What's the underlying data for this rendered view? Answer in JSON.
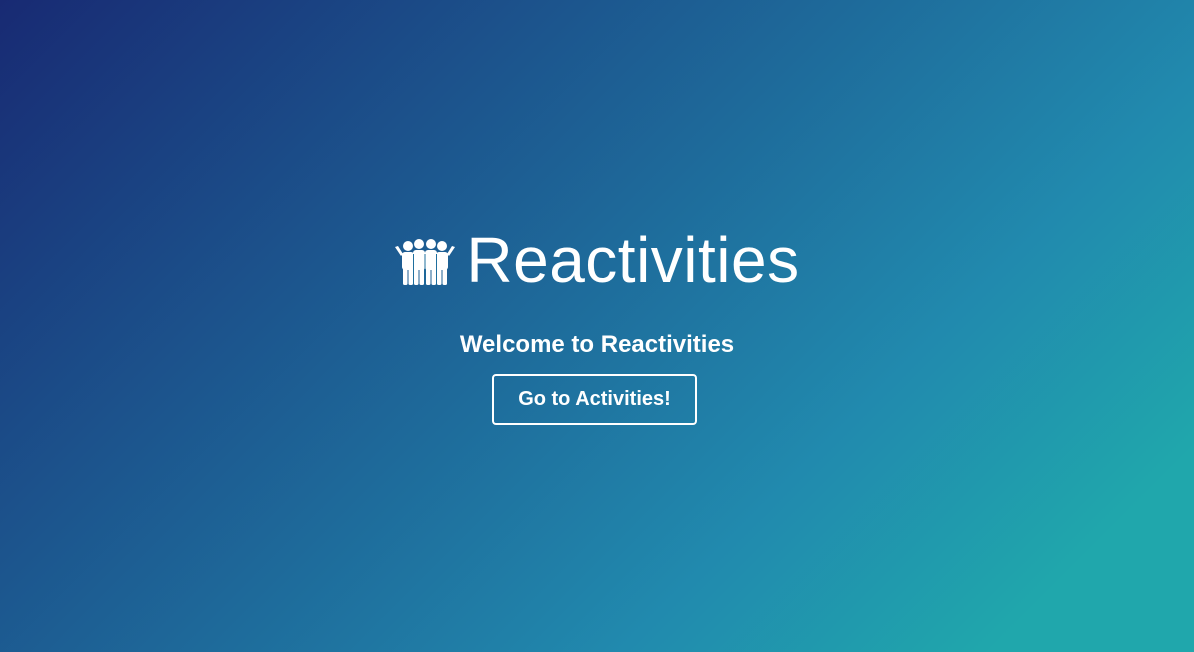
{
  "masthead": {
    "title": "Reactivities",
    "logo_icon": "users-group-icon",
    "welcome_text": "Welcome to Reactivities",
    "cta_label": "Go to Activities!"
  },
  "colors": {
    "gradient_start": "#182a73",
    "gradient_mid": "#218aae",
    "gradient_end": "#20a7ac",
    "text": "#ffffff"
  }
}
